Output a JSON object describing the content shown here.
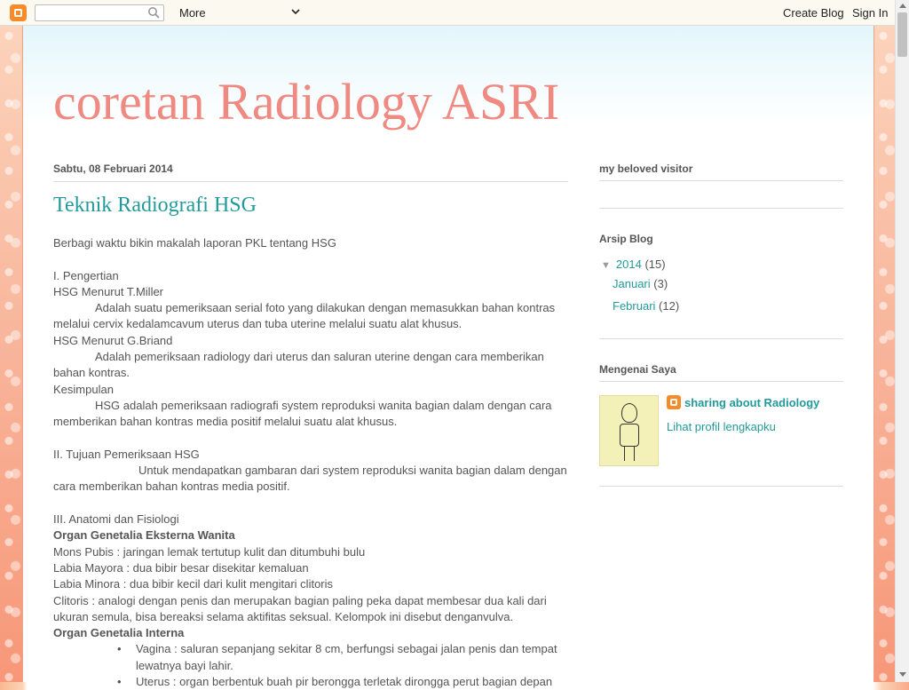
{
  "navbar": {
    "more_label": "More",
    "create_blog": "Create Blog",
    "sign_in": "Sign In",
    "search_placeholder": ""
  },
  "blog": {
    "title": "coretan Radiology ASRI"
  },
  "post": {
    "date": "Sabtu, 08 Februari 2014",
    "title": "Teknik Radiografi HSG",
    "lines": [
      {
        "text": "Berbagi waktu bikin makalah laporan PKL tentang HSG",
        "style": "normal"
      },
      {
        "text": "",
        "style": "blank"
      },
      {
        "text": "I. Pengertian",
        "style": "normal"
      },
      {
        "text": "HSG Menurut T.Miller",
        "style": "normal"
      },
      {
        "text": "Adalah suatu pemeriksaan serial foto yang dilakukan dengan memasukkan bahan kontras melalui cervix kedalamcavum uterus dan tuba uterine melalui suatu alat khusus.",
        "style": "indent1"
      },
      {
        "text": "HSG Menurut G.Briand",
        "style": "normal"
      },
      {
        "text": "Adalah pemeriksaan radiology dari uterus dan saluran uterine dengan cara memberikan bahan kontras.",
        "style": "indent1"
      },
      {
        "text": "Kesimpulan",
        "style": "normal"
      },
      {
        "text": "HSG adalah pemeriksaan radiografi system reproduksi wanita bagian dalam dengan cara memberikan bahan kontras media positif melalui suatu alat khusus.",
        "style": "indent1"
      },
      {
        "text": "",
        "style": "blank"
      },
      {
        "text": "II. Tujuan Pemeriksaan HSG",
        "style": "normal"
      },
      {
        "text": "Untuk mendapatkan gambaran dari system reproduksi wanita bagian dalam dengan cara memberikan bahan kontras media positif.",
        "style": "indent2"
      },
      {
        "text": "",
        "style": "blank"
      },
      {
        "text": "III. Anatomi dan Fisiologi",
        "style": "normal"
      },
      {
        "text": "Organ Genetalia Eksterna Wanita",
        "style": "bold"
      },
      {
        "text": "Mons Pubis : jaringan lemak tertutup kulit dan ditumbuhi bulu",
        "style": "normal"
      },
      {
        "text": "Labia Mayora : dua bibir besar disekitar kemaluan",
        "style": "normal"
      },
      {
        "text": "Labia Minora : dua bibir kecil dari kulit mengitari clitoris",
        "style": "normal"
      },
      {
        "text": "Clitoris       : analogi dengan penis dan merupakan bagian paling peka dapat membesar dua kali dari ukuran semula, bisa bereaksi selama aktifitas seksual. Kelompok ini disebut denganvulva.",
        "style": "normal"
      },
      {
        "text": "Organ Genetalia Interna",
        "style": "bold"
      },
      {
        "text": "Vagina : saluran sepanjang sekitar 8 cm, berfungsi sebagai jalan penis dan tempat lewatnya bayi lahir.",
        "style": "bullet"
      },
      {
        "text": "Uterus : organ berbentuk buah pir berongga terletak dirongga perut bagian depan",
        "style": "bullet"
      }
    ]
  },
  "sidebar": {
    "visitor_title": "my beloved visitor",
    "archive_title": "Arsip Blog",
    "archive": {
      "year": "2014",
      "year_count": "(15)",
      "months": [
        {
          "label": "Januari",
          "count": "(3)"
        },
        {
          "label": "Februari",
          "count": "(12)"
        }
      ]
    },
    "about_title": "Mengenai Saya",
    "profile_name": "sharing about Radiology",
    "profile_link": "Lihat profil lengkapku"
  },
  "colors": {
    "title": "#ef8a82",
    "link": "#239a9a",
    "blogger": "#f68b27"
  }
}
